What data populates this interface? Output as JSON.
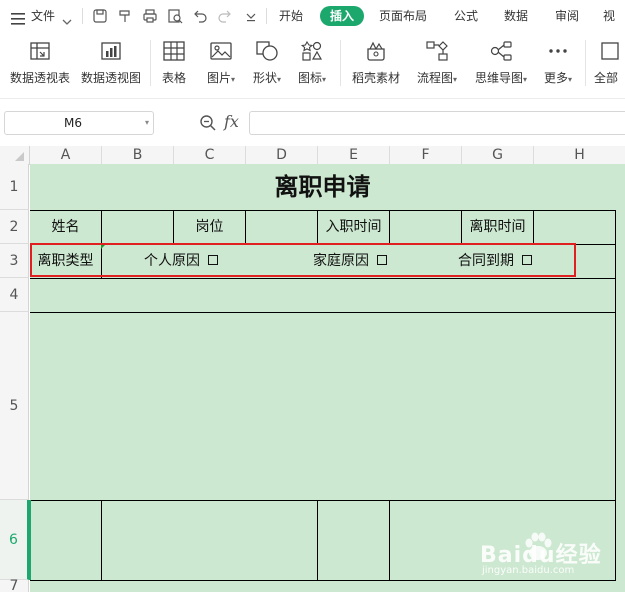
{
  "menubar": {
    "file_label": "文件",
    "tabs": [
      {
        "label": "开始",
        "active": false
      },
      {
        "label": "插入",
        "active": true
      },
      {
        "label": "页面布局",
        "active": false
      },
      {
        "label": "公式",
        "active": false
      },
      {
        "label": "数据",
        "active": false
      },
      {
        "label": "审阅",
        "active": false
      },
      {
        "label": "视图",
        "active": false
      }
    ],
    "accent_color": "#1ca86c"
  },
  "ribbon": {
    "pivot_table": "数据透视表",
    "pivot_chart": "数据透视图",
    "table": "表格",
    "picture": "图片",
    "shape": "形状",
    "icon": "图标",
    "material": "稻壳素材",
    "flowchart": "流程图",
    "mindmap": "思维导图",
    "more": "更多",
    "all": "全部"
  },
  "formula_bar": {
    "cell_ref": "M6",
    "fx_label": "fx",
    "formula": ""
  },
  "columns": [
    "A",
    "B",
    "C",
    "D",
    "E",
    "F",
    "G",
    "H"
  ],
  "rows": [
    "1",
    "2",
    "3",
    "4",
    "5",
    "6",
    "7"
  ],
  "selected_row": "6",
  "sheet": {
    "title": "离职申请",
    "name_label": "姓名",
    "position_label": "岗位",
    "hire_date_label": "入职时间",
    "leave_date_label": "离职时间",
    "leave_type_label": "离职类型",
    "option_personal": "个人原因",
    "option_family": "家庭原因",
    "option_contract": "合同到期",
    "fill_color": "#cde8d1",
    "highlight_color": "#e02020"
  },
  "watermark": {
    "brand": "Baidu经验",
    "url": "jingyan.baidu.com"
  }
}
